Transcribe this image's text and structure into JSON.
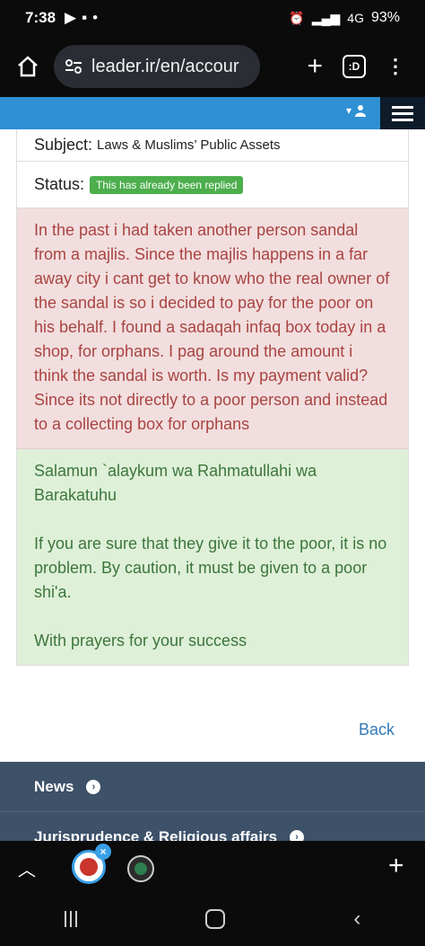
{
  "status_bar": {
    "time": "7:38",
    "network": "4G",
    "battery": "93%"
  },
  "browser": {
    "url": "leader.ir/en/accour",
    "tabs_count": ":D"
  },
  "ticket": {
    "subject_label": "Subject:",
    "subject_value": "Laws & Muslims’ Public Assets",
    "status_label": "Status:",
    "status_badge": "This has already been replied",
    "question": "In the past i had taken another person sandal from a majlis. Since the majlis happens in a far away city i cant get to know who the real owner of the sandal is so i decided to pay for the poor on his behalf. I found a sadaqah infaq box today in a shop, for orphans. I pag around the amount i think the sandal is worth. Is my payment valid? Since its not directly to a poor person and instead to a collecting box for orphans",
    "answer_greeting": "Salamun `alaykum wa Rahmatullahi wa Barakatuhu",
    "answer_body": "If you are sure that they give it to the poor, it is no problem. By caution, it must be given to a poor shi'a.",
    "answer_closing": "With prayers for your success"
  },
  "back_link": "Back",
  "footer_menu": [
    {
      "label": "News"
    },
    {
      "label": "Jurisprudence & Religious affairs"
    }
  ],
  "colors": {
    "site_bar": "#2f90d4",
    "question_bg": "#f2dede",
    "question_text": "#a94442",
    "answer_bg": "#dff0d8",
    "answer_text": "#3c763d",
    "badge": "#4cae4c",
    "footer": "#3d5169"
  }
}
